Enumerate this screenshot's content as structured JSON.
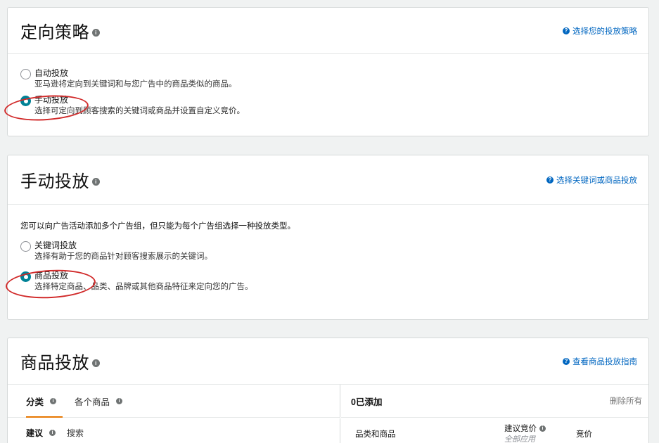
{
  "targeting_strategy": {
    "title": "定向策略",
    "help_link": "选择您的投放策略",
    "options": [
      {
        "label": "自动投放",
        "description": "亚马逊将定向到关键词和与您广告中的商品类似的商品。",
        "selected": false
      },
      {
        "label": "手动投放",
        "description": "选择可定向到顾客搜索的关键词或商品并设置自定义竞价。",
        "selected": true
      }
    ]
  },
  "manual_targeting": {
    "title": "手动投放",
    "help_link": "选择关键词或商品投放",
    "intro": "您可以向广告活动添加多个广告组，但只能为每个广告组选择一种投放类型。",
    "options": [
      {
        "label": "关键词投放",
        "description": "选择有助于您的商品针对顾客搜索展示的关键词。",
        "selected": false
      },
      {
        "label": "商品投放",
        "description": "选择特定商品、品类、品牌或其他商品特征来定向您的广告。",
        "selected": true
      }
    ]
  },
  "product_targeting": {
    "title": "商品投放",
    "help_link": "查看商品投放指南",
    "tabs": [
      {
        "label": "分类",
        "active": true
      },
      {
        "label": "各个商品",
        "active": false
      }
    ],
    "subtabs": [
      {
        "label": "建议",
        "active": true
      },
      {
        "label": "搜索",
        "active": false
      }
    ],
    "added": {
      "title": "0已添加",
      "remove_all": "删除所有",
      "columns": {
        "category_product": "品类和商品",
        "suggested_bid": "建议竞价",
        "apply_all": "全部应用",
        "bid": "竞价"
      }
    }
  },
  "colors": {
    "accent": "#008296",
    "link": "#0066c0",
    "annotation": "#d12a2a",
    "tab_underline": "#e77600"
  }
}
